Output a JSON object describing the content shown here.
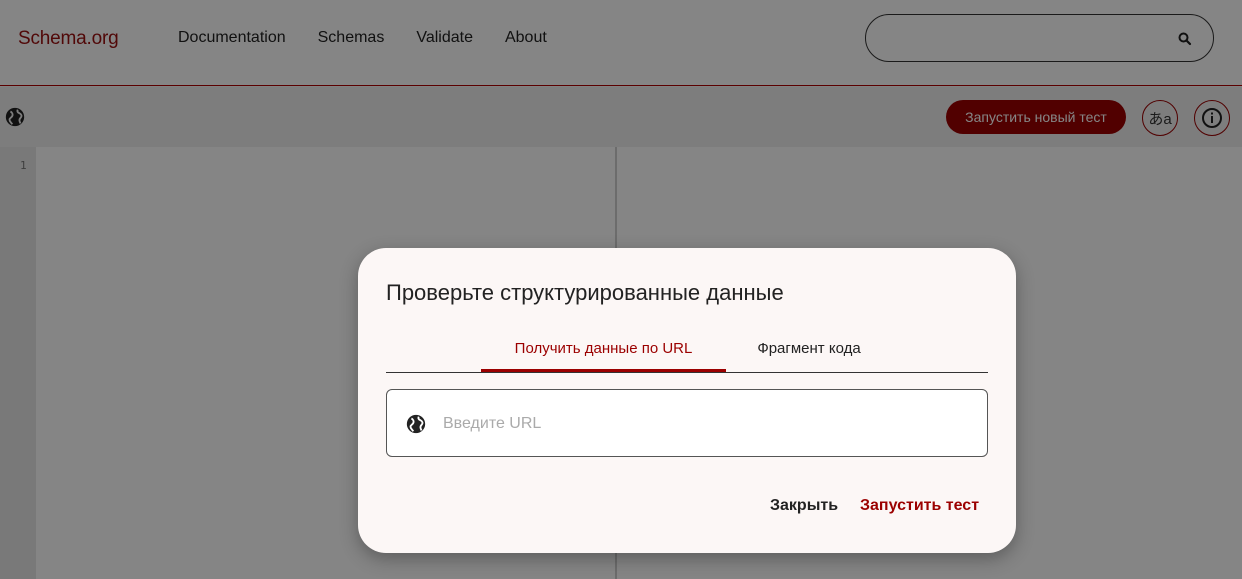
{
  "header": {
    "logo": "Schema.org",
    "nav": [
      "Documentation",
      "Schemas",
      "Validate",
      "About"
    ],
    "search_placeholder": ""
  },
  "toolbar": {
    "run_new_test": "Запустить новый тест",
    "lang_icon": "あa",
    "info_icon": "i"
  },
  "editor": {
    "line_numbers": [
      "1"
    ]
  },
  "dialog": {
    "title": "Проверьте структурированные данные",
    "tabs": [
      {
        "label": "Получить данные по URL",
        "active": true
      },
      {
        "label": "Фрагмент кода",
        "active": false
      }
    ],
    "url_placeholder": "Введите URL",
    "close_label": "Закрыть",
    "run_label": "Запустить тест"
  },
  "colors": {
    "accent": "#9b0000",
    "overlay": "rgba(0,0,0,0.48)"
  }
}
